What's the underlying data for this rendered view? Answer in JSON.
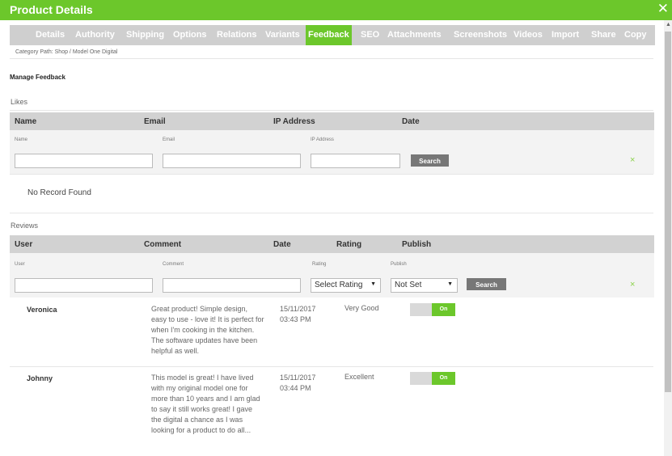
{
  "window": {
    "title": "Product Details",
    "close_icon": "close-icon"
  },
  "tabs": [
    {
      "label": "Details"
    },
    {
      "label": "Authority"
    },
    {
      "label": "Shipping"
    },
    {
      "label": "Options"
    },
    {
      "label": "Relations"
    },
    {
      "label": "Variants"
    },
    {
      "label": "Feedback",
      "active": true
    },
    {
      "label": "SEO"
    },
    {
      "label": "Attachments"
    },
    {
      "label": "Screenshots"
    },
    {
      "label": "Videos"
    },
    {
      "label": "Import"
    },
    {
      "label": "Share"
    },
    {
      "label": "Copy"
    }
  ],
  "breadcrumb": "Category Path:  Shop  / Model One Digital",
  "section_title": "Manage Feedback",
  "likes": {
    "heading": "Likes",
    "columns": [
      "Name",
      "Email",
      "IP Address",
      "Date"
    ],
    "filter_labels": [
      "Name",
      "Email",
      "IP Address"
    ],
    "filter_values": [
      "",
      "",
      ""
    ],
    "search_label": "Search",
    "clear_icon": "×",
    "empty_message": "No Record Found"
  },
  "reviews": {
    "heading": "Reviews",
    "columns": [
      "User",
      "Comment",
      "Date",
      "Rating",
      "Publish"
    ],
    "filter_labels": [
      "User",
      "Comment",
      "Rating",
      "Publish"
    ],
    "filter_values": [
      "",
      ""
    ],
    "rating_select": "Select Rating",
    "publish_select": "Not Set",
    "search_label": "Search",
    "clear_icon": "×",
    "rows": [
      {
        "user": "Veronica",
        "comment": "Great product! Simple design, easy to use - love it! It is perfect for when I'm cooking in the kitchen. The software updates have been helpful as well.",
        "date": "15/11/2017 03:43 PM",
        "rating": "Very Good",
        "publish": "On"
      },
      {
        "user": "Johnny",
        "comment": "This model is great! I have lived with my original model one for more than 10 years and I am glad to say it still works great! I gave the digital a chance as I was looking for a product to do all...",
        "date": "15/11/2017 03:44 PM",
        "rating": "Excellent",
        "publish": "On"
      }
    ]
  },
  "colors": {
    "accent": "#6cc72b",
    "tab_bar": "#cfcfcf",
    "header_row": "#d2d2d2"
  }
}
